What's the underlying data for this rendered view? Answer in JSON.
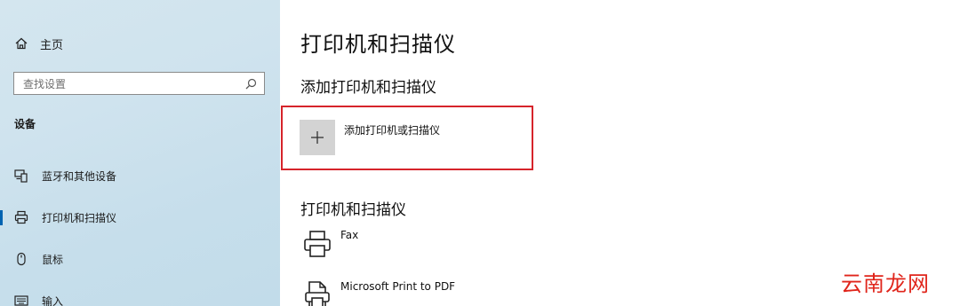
{
  "sidebar": {
    "home_label": "主页",
    "search_placeholder": "查找设置",
    "section_title": "设备",
    "items": [
      {
        "label": "蓝牙和其他设备",
        "icon": "bluetooth-devices-icon"
      },
      {
        "label": "打印机和扫描仪",
        "icon": "printer-icon",
        "selected": true
      },
      {
        "label": "鼠标",
        "icon": "mouse-icon"
      },
      {
        "label": "输入",
        "icon": "keyboard-icon"
      }
    ]
  },
  "main": {
    "page_title": "打印机和扫描仪",
    "add_section_title": "添加打印机和扫描仪",
    "add_button_label": "添加打印机或扫描仪",
    "list_title": "打印机和扫描仪",
    "printers": [
      {
        "name": "Fax",
        "icon": "fax-printer-icon"
      },
      {
        "name": "Microsoft Print to PDF",
        "icon": "pdf-printer-icon"
      }
    ]
  },
  "watermark": "云南龙网",
  "colors": {
    "accent": "#0063b1",
    "highlight_border": "#d6242b",
    "sidebar_bg": "#cfe3ee",
    "watermark": "#e0251b"
  }
}
